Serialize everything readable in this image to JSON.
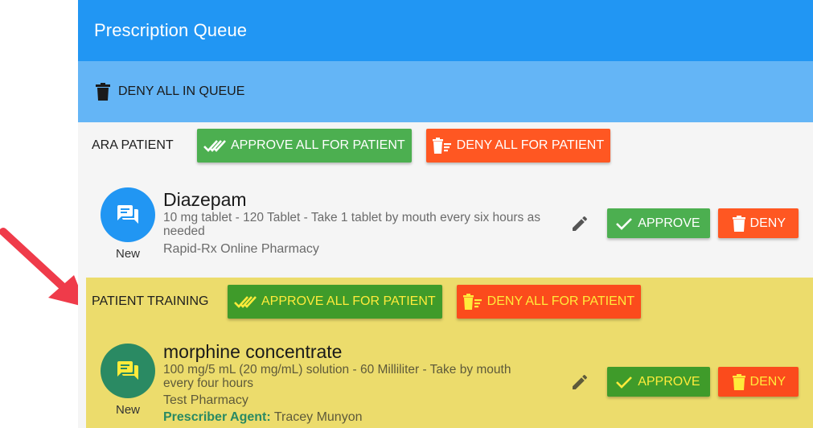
{
  "toolbar": {
    "title": "Prescription Queue"
  },
  "queue_actions": {
    "deny_all_label": "DENY ALL IN QUEUE"
  },
  "patients": [
    {
      "name": "ARA PATIENT",
      "approve_all_label": "APPROVE ALL FOR PATIENT",
      "deny_all_label": "DENY ALL FOR PATIENT",
      "prescription": {
        "status": "New",
        "drug": "Diazepam",
        "detail": "10 mg tablet - 120 Tablet - Take 1 tablet by mouth every six hours as needed",
        "pharmacy": "Rapid-Rx Online Pharmacy",
        "approve_label": "APPROVE",
        "deny_label": "DENY"
      }
    },
    {
      "name": "PATIENT TRAINING",
      "approve_all_label": "APPROVE ALL FOR PATIENT",
      "deny_all_label": "DENY ALL FOR PATIENT",
      "prescription": {
        "status": "New",
        "drug": "morphine concentrate",
        "detail": "100 mg/5 mL (20 mg/mL) solution - 60 Milliliter - Take by mouth every four hours",
        "pharmacy": "Test Pharmacy",
        "prescriber_label": "Prescriber Agent:",
        "prescriber_name": "Tracey Munyon",
        "approve_label": "APPROVE",
        "deny_label": "DENY"
      }
    }
  ],
  "colors": {
    "primary": "#2196f3",
    "primary_light": "#64b5f6",
    "approve": "#4caf50",
    "deny": "#ff5722",
    "highlight": "#ecdc6c",
    "highlight_text": "#ffeb3b",
    "annotation_arrow": "#ef3b4a"
  },
  "icons": {
    "deny_all_queue": "trash-icon",
    "approve_all": "double-check-icon",
    "deny_all_patient": "trash-list-icon",
    "avatar": "chat-bubble-icon",
    "edit": "pencil-icon",
    "approve": "check-icon",
    "deny": "trash-icon"
  }
}
